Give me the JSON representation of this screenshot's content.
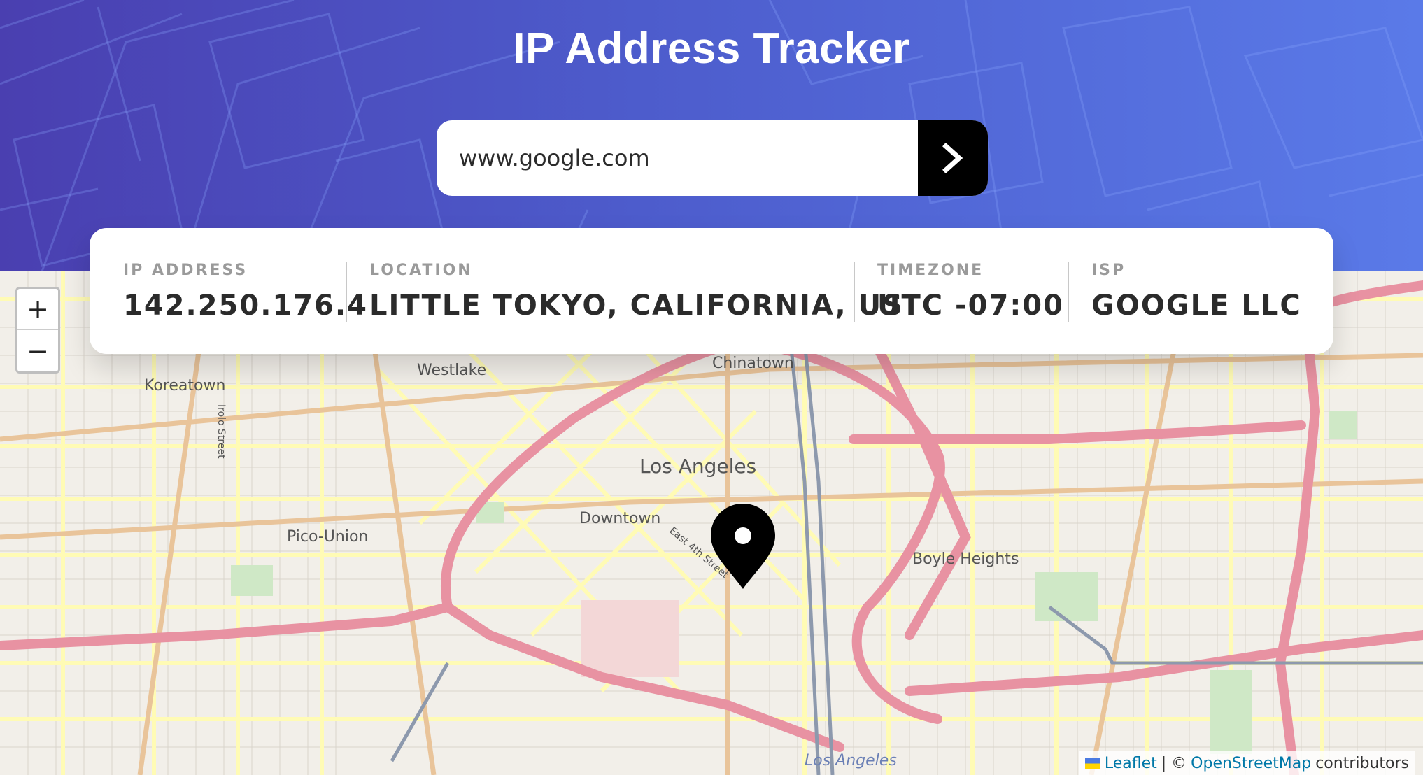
{
  "header": {
    "title": "IP Address Tracker",
    "search_value": "www.google.com",
    "submit_icon": "chevron-right-icon"
  },
  "info": {
    "ip_label": "IP ADDRESS",
    "ip_value": "142.250.176.4",
    "location_label": "LOCATION",
    "location_value": "LITTLE TOKYO, CALIFORNIA, US",
    "timezone_label": "TIMEZONE",
    "timezone_value": "UTC -07:00",
    "isp_label": "ISP",
    "isp_value": "GOOGLE LLC"
  },
  "map": {
    "zoom_in": "+",
    "zoom_out": "−",
    "marker_icon": "location-pin-icon",
    "labels": [
      "Westlake",
      "Chinatown",
      "Koreatown",
      "Los Angeles",
      "Downtown",
      "Pico-Union",
      "Boyle Heights",
      "Los Angeles",
      "Irolo Street",
      "East 4th Street"
    ],
    "attribution": {
      "leaflet": "Leaflet",
      "separator": "| ©",
      "osm": "OpenStreetMap",
      "suffix": "contributors"
    }
  },
  "colors": {
    "header_start": "#4a3fb0",
    "header_end": "#5a7ae8",
    "card_label": "#9a9a9a",
    "card_value": "#2b2b2b",
    "button": "#000000"
  }
}
